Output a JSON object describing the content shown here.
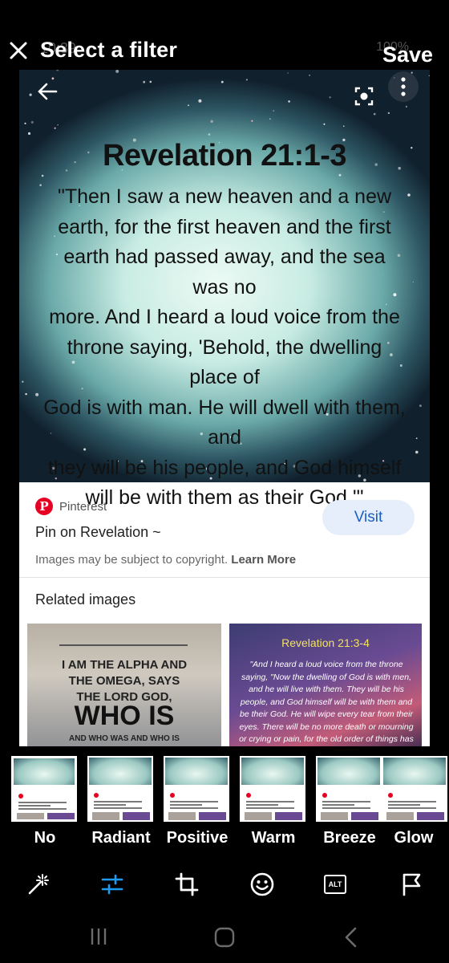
{
  "status_bar_ghost": {
    "time": "10:39",
    "battery": "100%"
  },
  "header": {
    "title": "Select a filter",
    "save_label": "Save"
  },
  "preview": {
    "verse_title": "Revelation 21:1-3",
    "verse_lines": [
      "\"Then I saw a new heaven and a new",
      "earth, for the first heaven and the first",
      "earth had passed away, and the sea was no",
      "more.  And I heard a loud voice from the",
      "throne saying, 'Behold, the dwelling place of",
      "God is with man. He will dwell with them, and",
      "they will be his people, and God himself",
      "will be with them as their God.'\""
    ],
    "source_logo": "P",
    "source_name": "Pinterest",
    "pin_title": "Pin on Revelation ~",
    "visit_label": "Visit",
    "copyright_text": "Images may be subject to copyright.",
    "learn_more": "Learn More",
    "related_title": "Related images",
    "related": [
      {
        "lines_small": [
          "I AM THE ALPHA AND",
          "THE OMEGA, SAYS",
          "THE LORD GOD,"
        ],
        "big": "WHO IS",
        "footer": "AND WHO WAS AND WHO IS"
      },
      {
        "title": "Revelation 21:3-4",
        "body": "\"And I heard a loud voice from the throne saying, \"Now the dwelling of God is with men, and he will live with them. They will be his people, and God himself will be with them and be their God. He will wipe every tear from their eyes. There will be no more death or mourning or crying or pain, for the old order of things has passed away.\""
      }
    ]
  },
  "filters": [
    {
      "label": "No",
      "selected": true
    },
    {
      "label": "Radiant",
      "selected": false
    },
    {
      "label": "Positive",
      "selected": false
    },
    {
      "label": "Warm",
      "selected": false
    },
    {
      "label": "Breeze",
      "selected": false
    },
    {
      "label": "Glow",
      "selected": false
    }
  ],
  "toolbar": {
    "tools": [
      {
        "name": "magic-wand-icon",
        "active": false
      },
      {
        "name": "adjust-sliders-icon",
        "active": true
      },
      {
        "name": "crop-icon",
        "active": false
      },
      {
        "name": "sticker-emoji-icon",
        "active": false
      },
      {
        "name": "alt-text-icon",
        "active": false,
        "label": "ALT"
      },
      {
        "name": "flag-icon",
        "active": false
      }
    ],
    "active_color": "#1d9bf0"
  }
}
